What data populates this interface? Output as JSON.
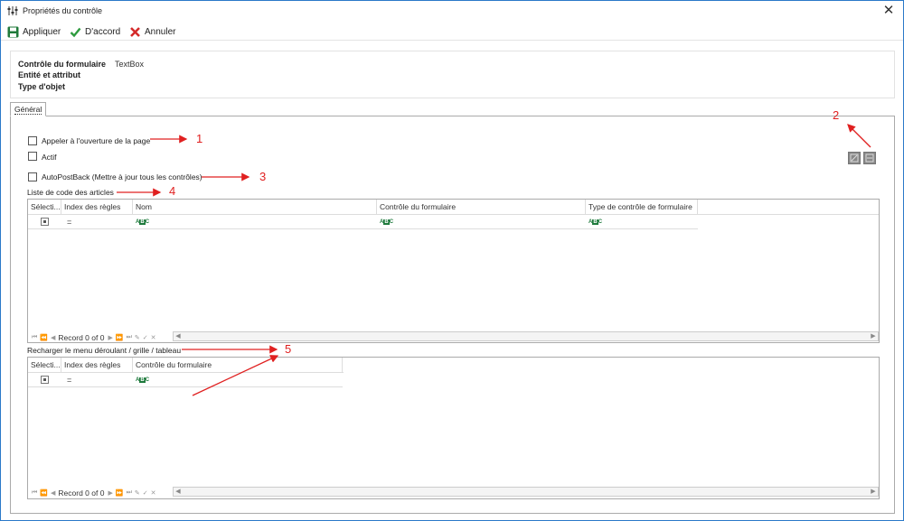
{
  "window": {
    "title": "Propriétés du contrôle"
  },
  "toolbar": {
    "apply": "Appliquer",
    "ok": "D'accord",
    "cancel": "Annuler"
  },
  "info": {
    "control_label": "Contrôle du formulaire",
    "control_value": "TextBox",
    "entity_label": "Entité et attribut",
    "type_label": "Type d'objet"
  },
  "tabs": [
    {
      "label": "Général"
    }
  ],
  "general": {
    "call_on_open": "Appeler à l'ouverture de la page",
    "active": "Actif",
    "autopostback": "AutoPostBack (Mettre à jour tous les contrôles)",
    "list_label": "Liste de code des articles",
    "reload_label": "Recharger le menu déroulant / grille / tableau"
  },
  "grid1": {
    "columns": [
      "Sélecti...",
      "Index des règles",
      "Nom",
      "Contrôle du formulaire",
      "Type de contrôle de formulaire"
    ],
    "record": "Record 0 of 0"
  },
  "grid2": {
    "columns": [
      "Sélecti...",
      "Index des règles",
      "Contrôle du formulaire"
    ],
    "record": "Record 0 of 0"
  },
  "annotations": [
    "1",
    "2",
    "3",
    "4",
    "5"
  ],
  "icons": {
    "title": "sliders-icon",
    "apply": "save-icon",
    "ok": "checkmark-icon",
    "cancel": "x-icon",
    "close": "close-icon"
  },
  "colors": {
    "accent_border": "#2b79c9",
    "annotation": "#e02020",
    "ok_green": "#2e9b3e",
    "cancel_red": "#d42a2a",
    "save_green": "#1f7a3a"
  }
}
